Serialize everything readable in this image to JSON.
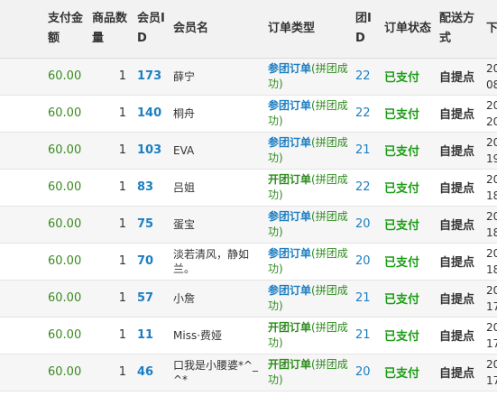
{
  "headers": [
    "支付金额",
    "商品数量",
    "会员ID",
    "会员名",
    "订单类型",
    "团ID",
    "订单状态",
    "配送方式",
    "下"
  ],
  "rows": [
    {
      "amount": "60.00",
      "qty": "1",
      "member_id": "173",
      "member_name": "薛宁",
      "order_type_main": "参团订单",
      "order_type_sub": "(拼团成功)",
      "order_type_kind": "join",
      "group_id": "22",
      "status": "已支付",
      "delivery": "自提点",
      "time_a": "20",
      "time_b": "08"
    },
    {
      "amount": "60.00",
      "qty": "1",
      "member_id": "140",
      "member_name": "桐舟",
      "order_type_main": "参团订单",
      "order_type_sub": "(拼团成功)",
      "order_type_kind": "join",
      "group_id": "22",
      "status": "已支付",
      "delivery": "自提点",
      "time_a": "20",
      "time_b": "20"
    },
    {
      "amount": "60.00",
      "qty": "1",
      "member_id": "103",
      "member_name": "EVA",
      "order_type_main": "参团订单",
      "order_type_sub": "(拼团成功)",
      "order_type_kind": "join",
      "group_id": "21",
      "status": "已支付",
      "delivery": "自提点",
      "time_a": "20",
      "time_b": "19"
    },
    {
      "amount": "60.00",
      "qty": "1",
      "member_id": "83",
      "member_name": "吕姐",
      "order_type_main": "开团订单",
      "order_type_sub": "(拼团成功)",
      "order_type_kind": "open",
      "group_id": "22",
      "status": "已支付",
      "delivery": "自提点",
      "time_a": "20",
      "time_b": "18"
    },
    {
      "amount": "60.00",
      "qty": "1",
      "member_id": "75",
      "member_name": "蛋宝",
      "order_type_main": "参团订单",
      "order_type_sub": "(拼团成功)",
      "order_type_kind": "join",
      "group_id": "20",
      "status": "已支付",
      "delivery": "自提点",
      "time_a": "20",
      "time_b": "18"
    },
    {
      "amount": "60.00",
      "qty": "1",
      "member_id": "70",
      "member_name": "淡若清风，静如兰。",
      "order_type_main": "参团订单",
      "order_type_sub": "(拼团成功)",
      "order_type_kind": "join",
      "group_id": "20",
      "status": "已支付",
      "delivery": "自提点",
      "time_a": "20",
      "time_b": "18"
    },
    {
      "amount": "60.00",
      "qty": "1",
      "member_id": "57",
      "member_name": "小詹",
      "order_type_main": "参团订单",
      "order_type_sub": "(拼团成功)",
      "order_type_kind": "join",
      "group_id": "21",
      "status": "已支付",
      "delivery": "自提点",
      "time_a": "20",
      "time_b": "17"
    },
    {
      "amount": "60.00",
      "qty": "1",
      "member_id": "11",
      "member_name": "Miss·费娅",
      "order_type_main": "开团订单",
      "order_type_sub": "(拼团成功)",
      "order_type_kind": "open",
      "group_id": "21",
      "status": "已支付",
      "delivery": "自提点",
      "time_a": "20",
      "time_b": "17"
    },
    {
      "amount": "60.00",
      "qty": "1",
      "member_id": "46",
      "member_name": "口我是小腰婆*^_^*",
      "order_type_main": "开团订单",
      "order_type_sub": "(拼团成功)",
      "order_type_kind": "open",
      "group_id": "20",
      "status": "已支付",
      "delivery": "自提点",
      "time_a": "20",
      "time_b": "17"
    }
  ],
  "colors": {
    "amount": "#3a8a1f",
    "member_id": "#1b7ec2",
    "order_join": "#1b7ec2",
    "order_open": "#2e8b1e",
    "status_paid": "#1b9d15"
  }
}
